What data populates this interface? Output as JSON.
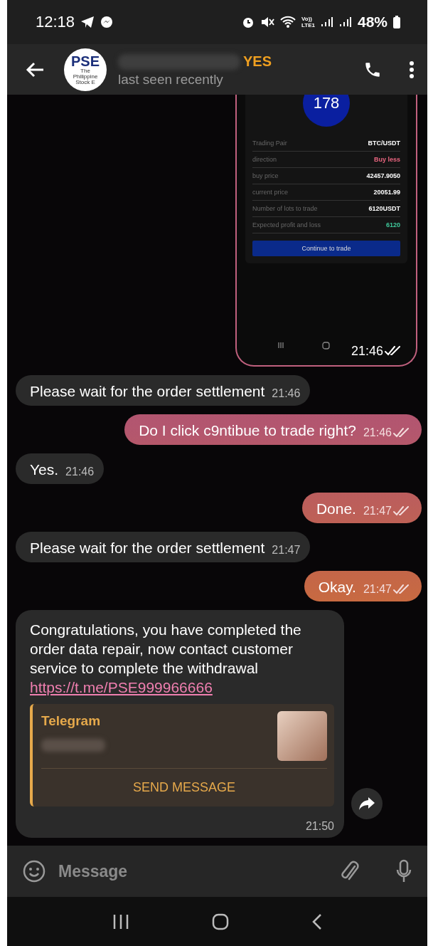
{
  "status_bar": {
    "time": "12:18",
    "network_top": "Vo))",
    "network_bottom": "LTE1",
    "battery": "48%"
  },
  "header": {
    "avatar_logo": "PSE",
    "avatar_caption": "The Philippine Stock E",
    "name_suffix": "YES",
    "status": "last seen recently"
  },
  "messages": [
    {
      "kind": "screenshot",
      "outgoing": true,
      "time": "21:46",
      "read": true,
      "badge": "178",
      "rows": [
        {
          "label": "Trading Pair",
          "value": "BTC/USDT",
          "color": "#ffffff"
        },
        {
          "label": "direction",
          "value": "Buy less",
          "color": "#e8657f"
        },
        {
          "label": "buy price",
          "value": "42457.9050",
          "color": "#ffffff"
        },
        {
          "label": "current price",
          "value": "20051.99",
          "color": "#ffffff"
        },
        {
          "label": "Number of lots to trade",
          "value": "6120USDT",
          "color": "#ffffff"
        },
        {
          "label": "Expected profit and loss",
          "value": "6120",
          "color": "#3fc79a"
        }
      ],
      "button": "Continue to trade"
    },
    {
      "kind": "text",
      "outgoing": false,
      "text": "Please wait for the order settlement",
      "time": "21:46",
      "read": false
    },
    {
      "kind": "text",
      "outgoing": true,
      "text": "Do I click c9ntibue to trade right?",
      "time": "21:46",
      "read": true
    },
    {
      "kind": "text",
      "outgoing": false,
      "text": "Yes.",
      "time": "21:46",
      "read": false
    },
    {
      "kind": "text",
      "outgoing": true,
      "text": "Done.",
      "time": "21:47",
      "read": true
    },
    {
      "kind": "text",
      "outgoing": false,
      "text": "Please wait for the order settlement",
      "time": "21:47",
      "read": false
    },
    {
      "kind": "text",
      "outgoing": true,
      "text": "Okay.",
      "time": "21:47",
      "read": true
    },
    {
      "kind": "link_preview",
      "outgoing": false,
      "text": "Congratulations, you have completed the order data repair, now contact customer service to complete the withdrawal",
      "link": "https://t.me/PSE999966666",
      "site": "Telegram",
      "button": "SEND MESSAGE",
      "time": "21:50",
      "read": false
    }
  ],
  "composer": {
    "placeholder": "Message"
  }
}
